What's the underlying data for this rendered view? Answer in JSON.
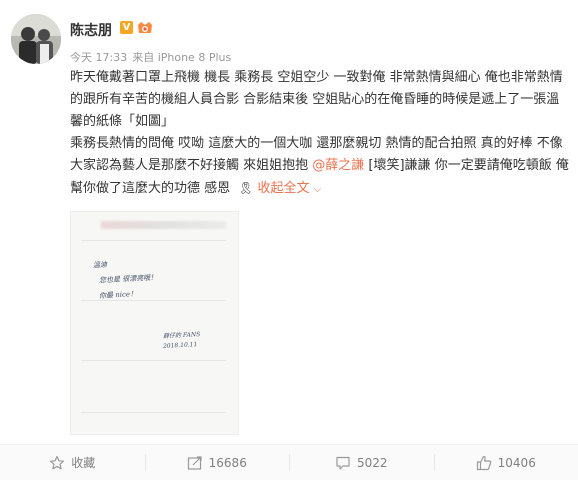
{
  "user": {
    "name": "陈志朋",
    "verified_badge": "V",
    "verified_color": "#f5a623"
  },
  "meta": {
    "time": "今天 17:33",
    "source": "来自 iPhone 8 Plus"
  },
  "post": {
    "paragraph1": "昨天俺戴著口罩上飛機 機長 乘務長 空姐空少 一致對俺 非常熱情與細心 俺也非常熱情的跟所有辛苦的機組人員合影 合影結束後 空姐貼心的在俺昏睡的時候是遞上了一張溫馨的紙條「如圖」",
    "paragraph2_a": "乘務長熱情的問俺 哎呦 這麼大的一個大咖 還那麼親切 熱情的配合拍照 真的好棒 不像大家認為藝人是那麼不好接觸 來姐姐抱抱 ",
    "mention": "@薛之謙",
    "paragraph2_b": " [壞笑]謙謙 你一定要請俺吃頓飯 俺幫你做了這麼大的功德 感恩 ",
    "emoji_icon": "ribbon-icon",
    "collapse_label": "收起全文",
    "accent_color": "#eb7350"
  },
  "photo": {
    "note_line1": "溫迪",
    "note_line2": "您也是 很漂亮哦！",
    "note_line3": "你最 nice！",
    "note_sign": "薛仔的 FANS",
    "note_date": "2018.10.11"
  },
  "actions": [
    {
      "icon": "star-icon",
      "label": "收藏"
    },
    {
      "icon": "share-icon",
      "label": "16686"
    },
    {
      "icon": "comment-icon",
      "label": "5022"
    },
    {
      "icon": "thumbs-up-icon",
      "label": "10406"
    }
  ]
}
